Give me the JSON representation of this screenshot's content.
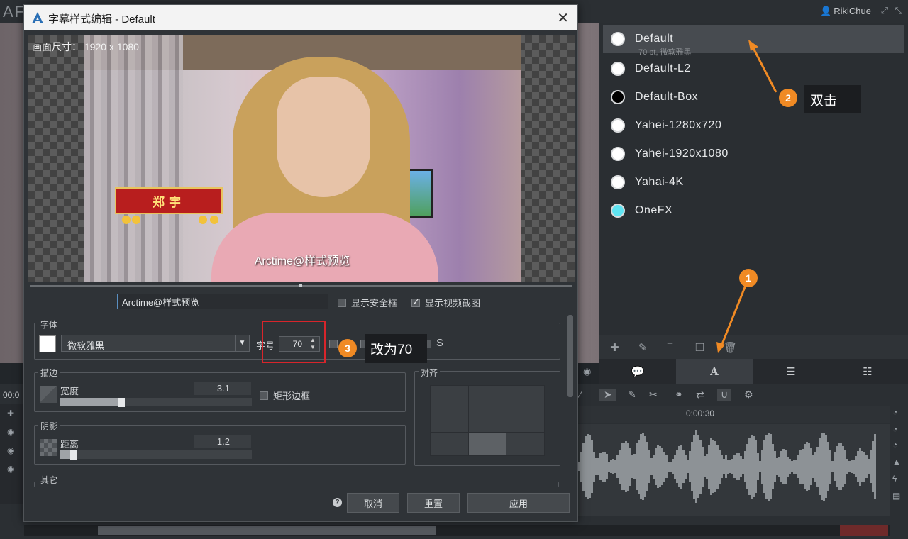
{
  "app": {
    "logo": "AF",
    "user": "RikiChue",
    "timecode_left": "00:0",
    "timecode_ruler": "0:00:30"
  },
  "style_list": {
    "items": [
      {
        "name": "Default",
        "sub": "70 pt, 微软雅黑",
        "selected": true,
        "dot": "#ffffff"
      },
      {
        "name": "Default-L2",
        "sub": "",
        "selected": false,
        "dot": "#ffffff"
      },
      {
        "name": "Default-Box",
        "sub": "",
        "selected": false,
        "dot": "#000000"
      },
      {
        "name": "Yahei-1280x720",
        "sub": "",
        "selected": false,
        "dot": "#ffffff"
      },
      {
        "name": "Yahei-1920x1080",
        "sub": "",
        "selected": false,
        "dot": "#ffffff"
      },
      {
        "name": "Yahai-4K",
        "sub": "",
        "selected": false,
        "dot": "#ffffff"
      },
      {
        "name": "OneFX",
        "sub": "",
        "selected": false,
        "dot": "#5fe4f2"
      }
    ]
  },
  "dialog": {
    "title": "字幕样式编辑 - Default",
    "preview_size": "画面尺寸： 1920 x 1080",
    "preview_sign": "郑宇",
    "preview_subtitle": "Arctime@样式预览",
    "preview_text_value": "Arctime@样式预览",
    "show_safe_frame": "显示安全框",
    "show_video_frame": "显示视频截图",
    "font_group": "字体",
    "font_name": "微软雅黑",
    "size_label": "字号",
    "size_value": "70",
    "border_group": "描边",
    "width_label": "宽度",
    "width_value": "3.1",
    "width_fraction": 0.3,
    "rect_border": "矩形边框",
    "shadow_group": "阴影",
    "distance_label": "距离",
    "distance_value": "1.2",
    "distance_fraction": 0.05,
    "other_group": "其它",
    "align_group": "对齐",
    "cancel": "取消",
    "reset": "重置",
    "apply": "应用"
  },
  "annotations": {
    "badge1": "1",
    "badge2": "2",
    "badge3": "3",
    "callout2": "双击",
    "callout3": "改为70"
  },
  "colors": {
    "accent_orange": "#f08a24",
    "highlight_red": "#d8252b",
    "callout_bg": "#1b1d20"
  }
}
